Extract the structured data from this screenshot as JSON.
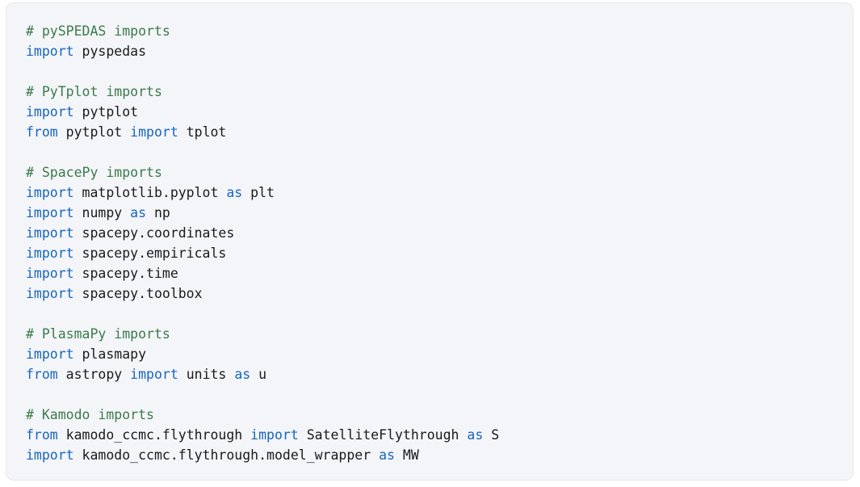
{
  "card": {
    "background_color": "#f4f5f9",
    "border_color": "#e3e8ee",
    "page_background": "#ffffff"
  },
  "syntax_colors": {
    "comment": "#3a7a4a",
    "keyword": "#1565c0",
    "plain": "#1a1a1a"
  },
  "code": {
    "language": "python",
    "lines": [
      {
        "tokens": [
          {
            "t": "comment",
            "s": "# pySPEDAS imports"
          }
        ]
      },
      {
        "tokens": [
          {
            "t": "keyword",
            "s": "import"
          },
          {
            "t": "plain",
            "s": " pyspedas"
          }
        ]
      },
      {
        "tokens": []
      },
      {
        "tokens": [
          {
            "t": "comment",
            "s": "# PyTplot imports"
          }
        ]
      },
      {
        "tokens": [
          {
            "t": "keyword",
            "s": "import"
          },
          {
            "t": "plain",
            "s": " pytplot"
          }
        ]
      },
      {
        "tokens": [
          {
            "t": "keyword",
            "s": "from"
          },
          {
            "t": "plain",
            "s": " pytplot "
          },
          {
            "t": "keyword",
            "s": "import"
          },
          {
            "t": "plain",
            "s": " tplot"
          }
        ]
      },
      {
        "tokens": []
      },
      {
        "tokens": [
          {
            "t": "comment",
            "s": "# SpacePy imports"
          }
        ]
      },
      {
        "tokens": [
          {
            "t": "keyword",
            "s": "import"
          },
          {
            "t": "plain",
            "s": " matplotlib.pyplot "
          },
          {
            "t": "keyword",
            "s": "as"
          },
          {
            "t": "plain",
            "s": " plt"
          }
        ]
      },
      {
        "tokens": [
          {
            "t": "keyword",
            "s": "import"
          },
          {
            "t": "plain",
            "s": " numpy "
          },
          {
            "t": "keyword",
            "s": "as"
          },
          {
            "t": "plain",
            "s": " np"
          }
        ]
      },
      {
        "tokens": [
          {
            "t": "keyword",
            "s": "import"
          },
          {
            "t": "plain",
            "s": " spacepy.coordinates"
          }
        ]
      },
      {
        "tokens": [
          {
            "t": "keyword",
            "s": "import"
          },
          {
            "t": "plain",
            "s": " spacepy.empiricals"
          }
        ]
      },
      {
        "tokens": [
          {
            "t": "keyword",
            "s": "import"
          },
          {
            "t": "plain",
            "s": " spacepy.time"
          }
        ]
      },
      {
        "tokens": [
          {
            "t": "keyword",
            "s": "import"
          },
          {
            "t": "plain",
            "s": " spacepy.toolbox"
          }
        ]
      },
      {
        "tokens": []
      },
      {
        "tokens": [
          {
            "t": "comment",
            "s": "# PlasmaPy imports"
          }
        ]
      },
      {
        "tokens": [
          {
            "t": "keyword",
            "s": "import"
          },
          {
            "t": "plain",
            "s": " plasmapy"
          }
        ]
      },
      {
        "tokens": [
          {
            "t": "keyword",
            "s": "from"
          },
          {
            "t": "plain",
            "s": " astropy "
          },
          {
            "t": "keyword",
            "s": "import"
          },
          {
            "t": "plain",
            "s": " units "
          },
          {
            "t": "keyword",
            "s": "as"
          },
          {
            "t": "plain",
            "s": " u"
          }
        ]
      },
      {
        "tokens": []
      },
      {
        "tokens": [
          {
            "t": "comment",
            "s": "# Kamodo imports"
          }
        ]
      },
      {
        "tokens": [
          {
            "t": "keyword",
            "s": "from"
          },
          {
            "t": "plain",
            "s": " kamodo_ccmc.flythrough "
          },
          {
            "t": "keyword",
            "s": "import"
          },
          {
            "t": "plain",
            "s": " SatelliteFlythrough "
          },
          {
            "t": "keyword",
            "s": "as"
          },
          {
            "t": "plain",
            "s": " S"
          }
        ]
      },
      {
        "tokens": [
          {
            "t": "keyword",
            "s": "import"
          },
          {
            "t": "plain",
            "s": " kamodo_ccmc.flythrough.model_wrapper "
          },
          {
            "t": "keyword",
            "s": "as"
          },
          {
            "t": "plain",
            "s": " MW"
          }
        ]
      }
    ]
  }
}
